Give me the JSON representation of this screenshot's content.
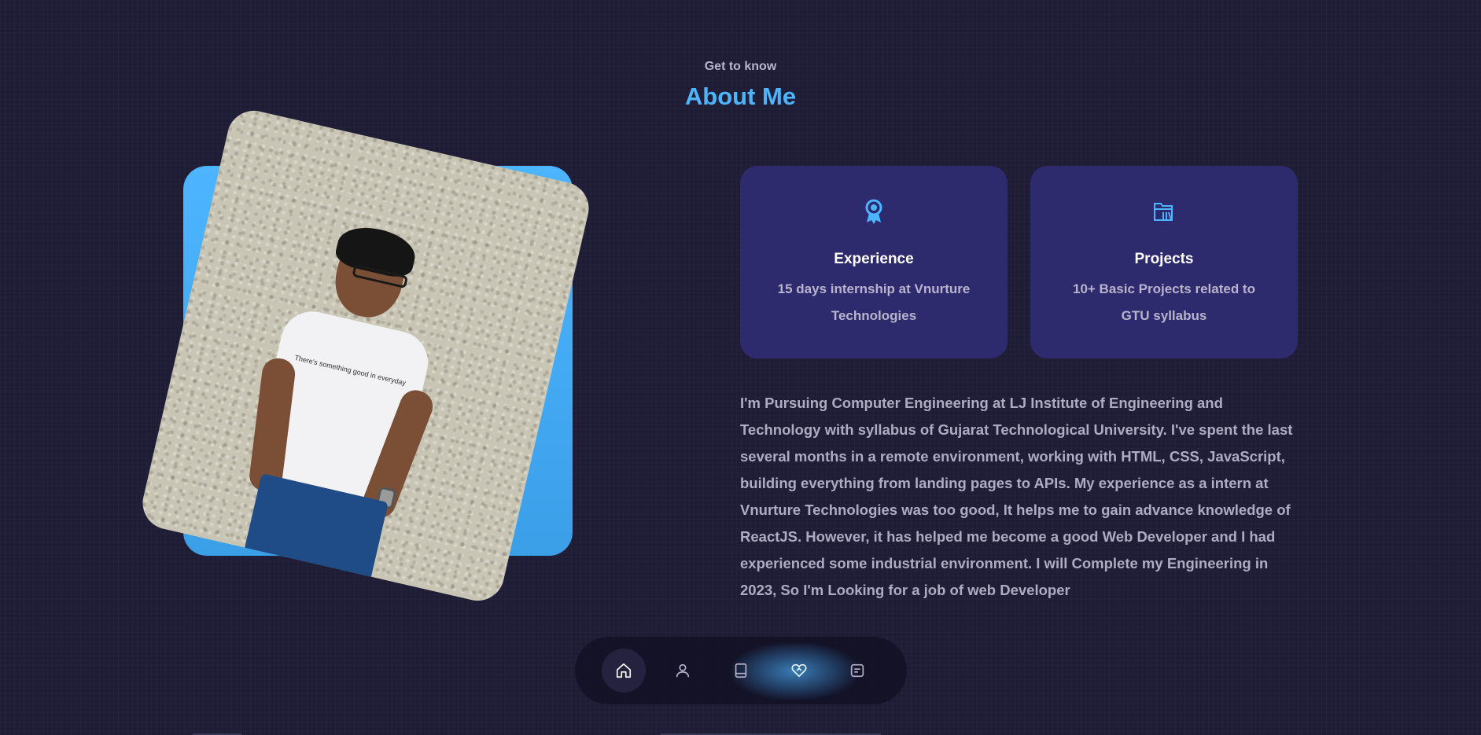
{
  "header": {
    "subtitle": "Get to know",
    "title": "About Me"
  },
  "photo": {
    "shirt_text": "There's something good in everyday"
  },
  "cards": [
    {
      "icon": "award-icon",
      "title": "Experience",
      "description": "15 days internship at Vnurture Technologies"
    },
    {
      "icon": "folder-library-icon",
      "title": "Projects",
      "description": "10+ Basic Projects related to GTU syllabus"
    }
  ],
  "about": {
    "text": "I'm Pursuing Computer Engineering at LJ Institute of Engineering and Technology with syllabus of Gujarat Technological University. I've spent the last several months in a remote environment, working with HTML, CSS, JavaScript, building everything from landing pages to APIs. My experience as a intern at Vnurture Technologies was too good, It helps me to gain advance knowledge of ReactJS. However, it has helped me become a good Web Developer and I had experienced some industrial environment. I will Complete my Engineering in 2023, So I'm Looking for a job of web Developer"
  },
  "nav": {
    "items": [
      {
        "icon": "home-icon",
        "active": true
      },
      {
        "icon": "user-icon",
        "active": false
      },
      {
        "icon": "book-icon",
        "active": false
      },
      {
        "icon": "heart-handshake-icon",
        "active": false
      },
      {
        "icon": "message-icon",
        "active": false
      }
    ]
  },
  "colors": {
    "background": "#1f1d36",
    "accent": "#4db5ff",
    "card": "#2d2a6e",
    "text_muted": "#aeabc2"
  }
}
